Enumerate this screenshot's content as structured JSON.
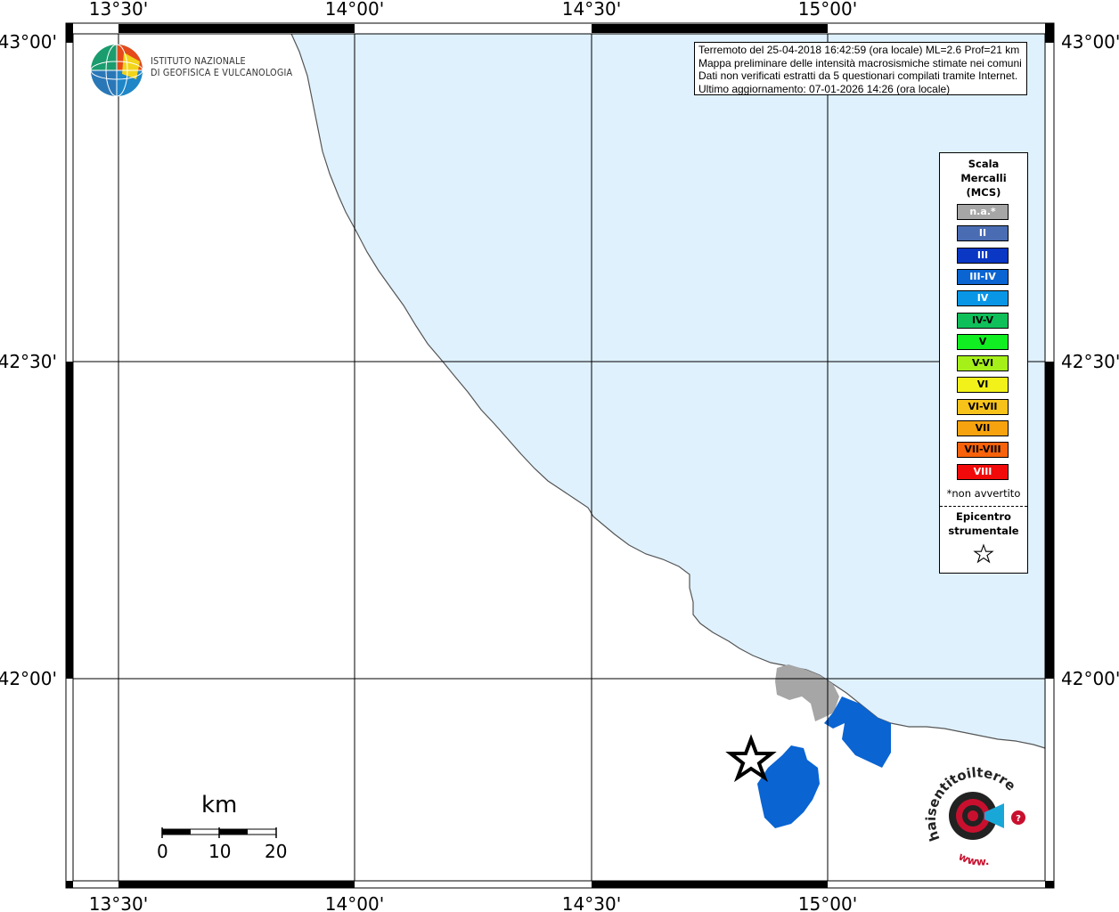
{
  "map": {
    "lon_labels": [
      "13°30'",
      "14°00'",
      "14°30'",
      "15°00'"
    ],
    "lat_labels": [
      "43°00'",
      "42°30'",
      "42°00'"
    ],
    "colors": {
      "sea": "#dff1fd",
      "land": "#ffffff",
      "not_felt": "#a6a6a6",
      "intensity_III_IV": "#0a64d2",
      "frame": "#000000"
    }
  },
  "institution": {
    "line1": "ISTITUTO NAZIONALE",
    "line2": "DI GEOFISICA E VULCANOLOGIA"
  },
  "info": {
    "line1": "Terremoto del 25-04-2018 16:42:59 (ora locale) ML=2.6 Prof=21 km",
    "line2": "Mappa preliminare delle intensità macrosismiche stimate nei comuni",
    "line3": "Dati non verificati estratti da 5 questionari compilati tramite Internet.",
    "line4": "Ultimo aggiornamento: 07-01-2026 14:26 (ora locale)"
  },
  "legend": {
    "title_line1": "Scala",
    "title_line2": "Mercalli",
    "title_line3": "(MCS)",
    "items": [
      {
        "label": "n.a.*",
        "color": "#a6a6a6"
      },
      {
        "label": "II",
        "color": "#4a6cb3"
      },
      {
        "label": "III",
        "color": "#0a37c4"
      },
      {
        "label": "III-IV",
        "color": "#0a64d2"
      },
      {
        "label": "IV",
        "color": "#0a96e6"
      },
      {
        "label": "IV-V",
        "color": "#0fbf5a"
      },
      {
        "label": "V",
        "color": "#11ee22"
      },
      {
        "label": "V-VI",
        "color": "#a6f01a"
      },
      {
        "label": "VI",
        "color": "#f2f21a"
      },
      {
        "label": "VI-VII",
        "color": "#f7c21a"
      },
      {
        "label": "VII",
        "color": "#f7a30f"
      },
      {
        "label": "VII-VIII",
        "color": "#f7620a"
      },
      {
        "label": "VIII",
        "color": "#f20a0a"
      }
    ],
    "note": "*non avvertito",
    "epicenter_line1": "Epicentro",
    "epicenter_line2": "strumentale"
  },
  "scale_bar": {
    "unit": "km",
    "ticks": [
      "0",
      "10",
      "20"
    ]
  },
  "site_logo": {
    "text_main": "haisentitoilterremoto.it",
    "text_prefix": "www."
  }
}
